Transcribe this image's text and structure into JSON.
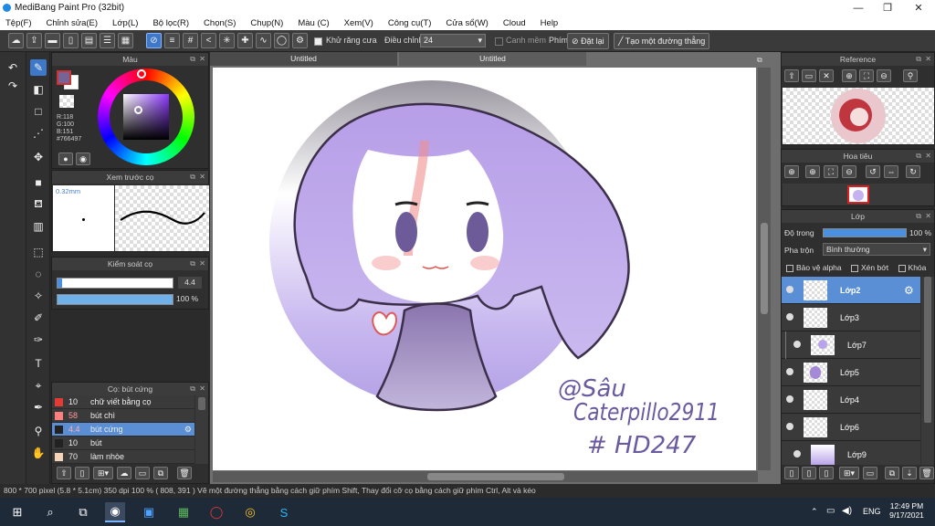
{
  "window": {
    "title": "MediBang Paint Pro (32bit)",
    "min": "—",
    "max": "❐",
    "close": "✕"
  },
  "menu": [
    "Tệp(F)",
    "Chỉnh sửa(E)",
    "Lớp(L)",
    "Bộ lọc(R)",
    "Chọn(S)",
    "Chụp(N)",
    "Màu (C)",
    "Xem(V)",
    "Công cụ(T)",
    "Cửa sổ(W)",
    "Cloud",
    "Help"
  ],
  "toolbar": {
    "antialias_label": "Khử răng cưa",
    "adjust_label": "Điều chỉnh",
    "adjust_value": "24",
    "snap_label": "Canh mềm",
    "keys_label": "Phím",
    "reset_label": "Đặt lại",
    "straight_line_label": "Tạo một đường thẳng"
  },
  "color_panel": {
    "title": "Màu",
    "r": "R:118",
    "g": "G:100",
    "b": "B:151",
    "hex": "#766497",
    "fg_color": "#766497",
    "bg_color": "#ffffff"
  },
  "brush_preview": {
    "title": "Xem trước cọ",
    "size": "0.32mm"
  },
  "brush_control": {
    "title": "Kiểm soát cọ",
    "size_value": "4.4",
    "opacity_value": "100 %",
    "size_fraction": 0.04,
    "opacity_fraction": 1.0
  },
  "brush_list": {
    "title": "Cọ: bút cứng",
    "items": [
      {
        "size": "10",
        "name": "chữ viết bằng cọ",
        "color": "#e53935"
      },
      {
        "size": "58",
        "name": "bút chì",
        "color": "#ff7f7f"
      },
      {
        "size": "4.4",
        "name": "bút cứng",
        "color": "#222222",
        "active": true
      },
      {
        "size": "10",
        "name": "bút",
        "color": "#222222"
      },
      {
        "size": "70",
        "name": "làm nhòe",
        "color": "#f5d3b8"
      }
    ]
  },
  "tabs": [
    "Untitled",
    "Untitled"
  ],
  "artwork": {
    "signature_line1": "@Sâu",
    "signature_line2": "Caterpillo2911",
    "signature_line3": "# HD247"
  },
  "reference_panel": {
    "title": "Reference"
  },
  "navigator_panel": {
    "title": "Hoa tiêu"
  },
  "layer_panel": {
    "title": "Lớp",
    "opacity_label": "Độ trong",
    "opacity_value": "100 %",
    "blend_label": "Pha trộn",
    "blend_value": "Bình thường",
    "protect_alpha": "Bảo vệ alpha",
    "clipping": "Xén bớt",
    "lock": "Khóa",
    "layers": [
      "Lớp2",
      "Lớp3",
      "Lớp7",
      "Lớp5",
      "Lớp4",
      "Lớp6",
      "Lớp9"
    ]
  },
  "status": {
    "text": "800 * 700 pixel   (5.8 * 5.1cm)   350 dpi   100 %   ( 808, 391 )   Vẽ một đường thẳng bằng cách giữ phím Shift, Thay đổi cỡ cọ bằng cách giữ phím Ctrl, Alt và kéo"
  },
  "taskbar": {
    "lang": "ENG",
    "time": "12:49 PM",
    "date": "9/17/2021"
  }
}
